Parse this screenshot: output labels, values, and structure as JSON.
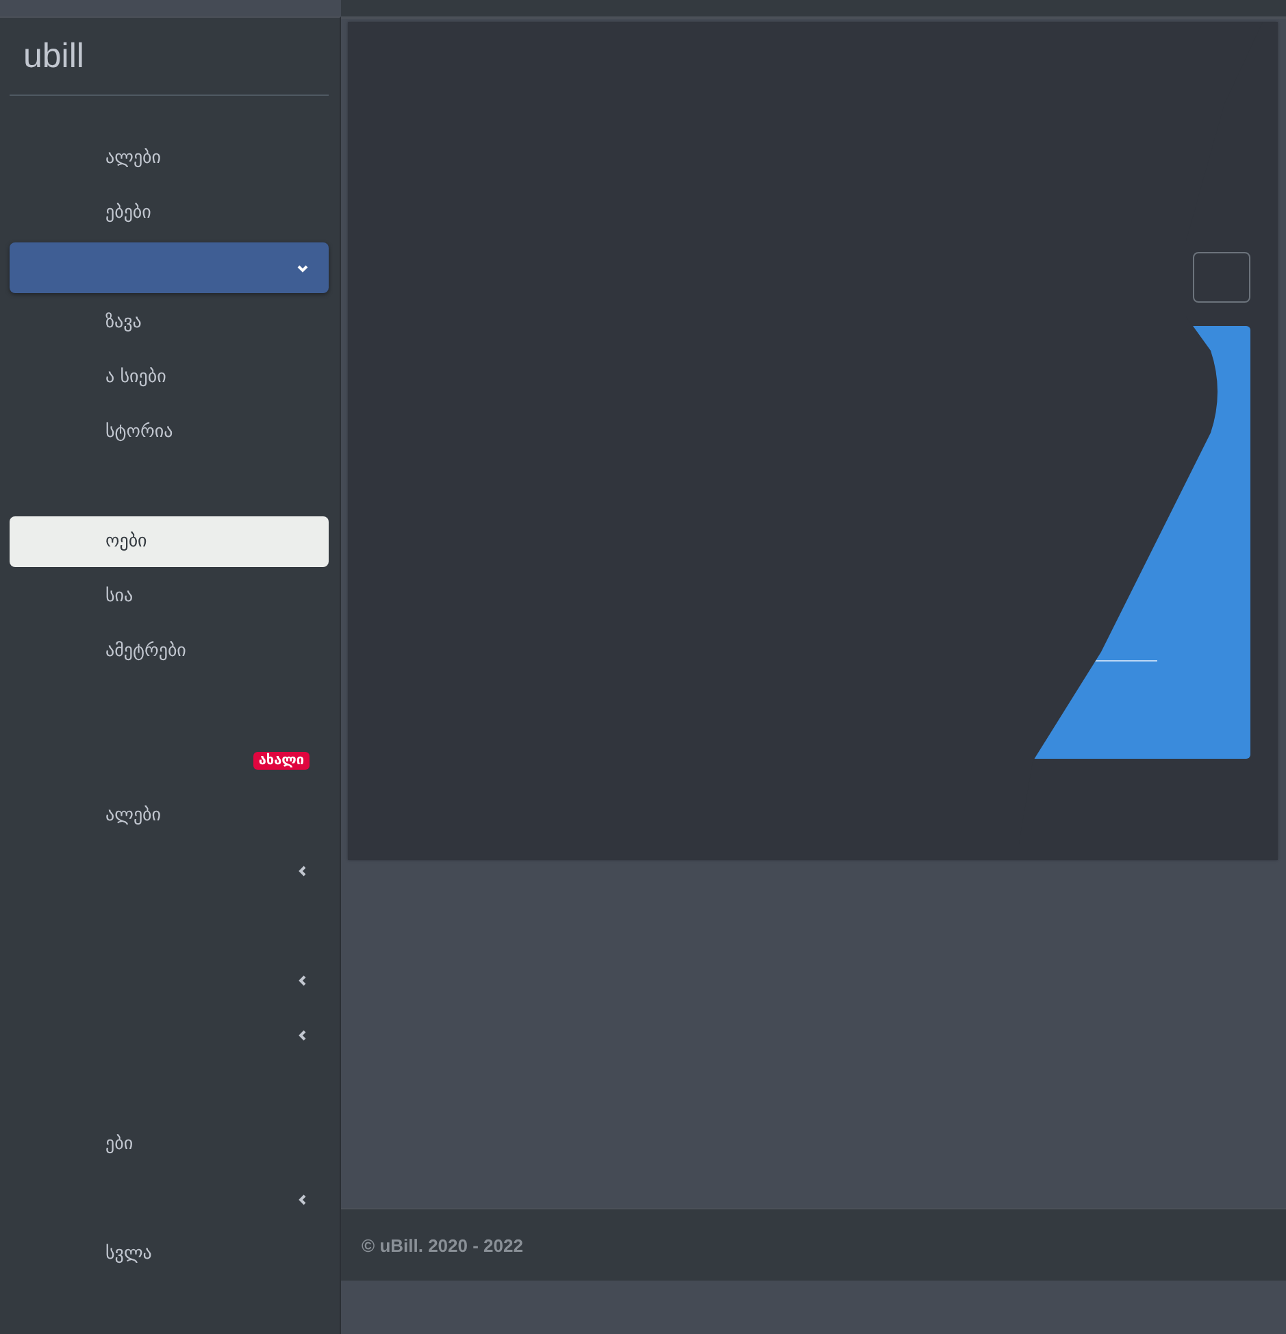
{
  "brand": {
    "title": "ubill"
  },
  "sidebar": {
    "items": [
      {
        "kind": "link",
        "label": "ალები",
        "selected": false
      },
      {
        "kind": "link",
        "label": "ებები",
        "selected": false
      },
      {
        "kind": "group",
        "expanded": true,
        "selected": false
      },
      {
        "kind": "link",
        "label": "ზავა",
        "selected": false
      },
      {
        "kind": "link",
        "label": "ა სიები",
        "selected": false
      },
      {
        "kind": "link",
        "label": "სტორია",
        "selected": false
      },
      {
        "kind": "blank",
        "selected": false
      },
      {
        "kind": "link",
        "label": "ოები",
        "selected": true
      },
      {
        "kind": "link",
        "label": "სია",
        "selected": false
      },
      {
        "kind": "link",
        "label": "ამეტრები",
        "selected": false
      },
      {
        "kind": "blank",
        "selected": false
      },
      {
        "kind": "badge",
        "badge": "ახალი",
        "selected": false
      },
      {
        "kind": "link",
        "label": "ალები",
        "selected": false
      },
      {
        "kind": "group",
        "expanded": false,
        "selected": false
      },
      {
        "kind": "blank",
        "selected": false
      },
      {
        "kind": "group",
        "expanded": false,
        "selected": false
      },
      {
        "kind": "group",
        "expanded": false,
        "selected": false
      },
      {
        "kind": "blank",
        "selected": false
      },
      {
        "kind": "link",
        "label": "ები",
        "selected": false
      },
      {
        "kind": "group",
        "expanded": false,
        "selected": false
      },
      {
        "kind": "link",
        "label": "სვლა",
        "selected": false
      }
    ]
  },
  "footer": {
    "text": "© uBill. 2020 - 2022"
  }
}
